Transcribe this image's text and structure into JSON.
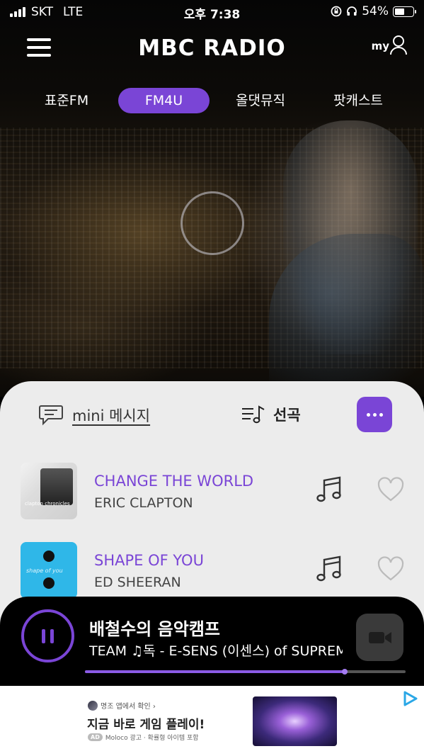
{
  "status_bar": {
    "carrier": "SKT",
    "network": "LTE",
    "time": "오후 7:38",
    "battery_text": "54%",
    "battery_level": 0.54
  },
  "header": {
    "logo": "MBC RADIO",
    "my_label": "my"
  },
  "channel_tabs": [
    {
      "label": "표준FM",
      "active": false
    },
    {
      "label": "FM4U",
      "active": true
    },
    {
      "label": "올댓뮤직",
      "active": false
    },
    {
      "label": "팟캐스트",
      "active": false
    }
  ],
  "sheet": {
    "mini_message_label": "mini 메시지",
    "playlist_label": "선곡",
    "songs": [
      {
        "title": "CHANGE THE WORLD",
        "artist": "ERIC CLAPTON",
        "album_art_text": "clapton chronicles"
      },
      {
        "title": "SHAPE OF YOU",
        "artist": "ED SHEERAN",
        "album_art_text": "shape of you"
      }
    ]
  },
  "player": {
    "program_title": "배철수의 음악캠프",
    "now_playing_marquee": "TEAM     ♫독 - E-SENS (이센스) of SUPREME TEAM",
    "progress": 0.81
  },
  "ad": {
    "source": "명조 앱에서 확인 ›",
    "headline": "지금 바로 게임 플레이!",
    "badge": "AD",
    "meta": "Moloco 광고 · 확률형 아이템 포함"
  },
  "colors": {
    "accent": "#7a45d6",
    "sheet_bg": "#ececec",
    "player_bg": "#000000"
  },
  "icons": [
    "menu-icon",
    "user-icon",
    "chat-bubble-icon",
    "playlist-icon",
    "more-icon",
    "music-note-icon",
    "heart-icon",
    "pause-icon",
    "video-camera-icon",
    "ad-choices-icon"
  ]
}
